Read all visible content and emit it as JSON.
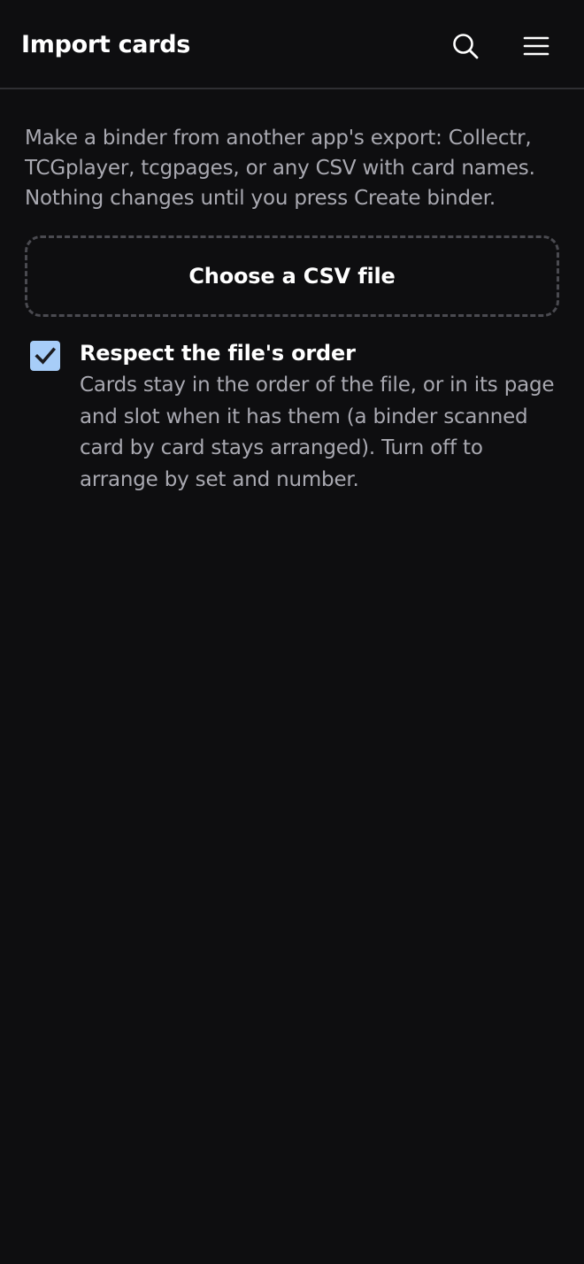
{
  "header": {
    "title": "Import cards",
    "search_icon": "search-icon",
    "menu_icon": "hamburger-menu-icon"
  },
  "intro": {
    "text": "Make a binder from another app's export: Collectr, TCGplayer, tcgpages, or any CSV with card names. Nothing changes until you press Create binder."
  },
  "file_picker": {
    "label": "Choose a CSV file"
  },
  "respect_order": {
    "checked": true,
    "title": "Respect the file's order",
    "description": "Cards stay in the order of the file, or in its page and slot when it has them (a binder scanned card by card stays arranged). Turn off to arrange by set and number."
  },
  "colors": {
    "background": "#0e0e10",
    "checkbox_fill": "#a7cdf8",
    "muted_text": "#a9a9b1"
  }
}
